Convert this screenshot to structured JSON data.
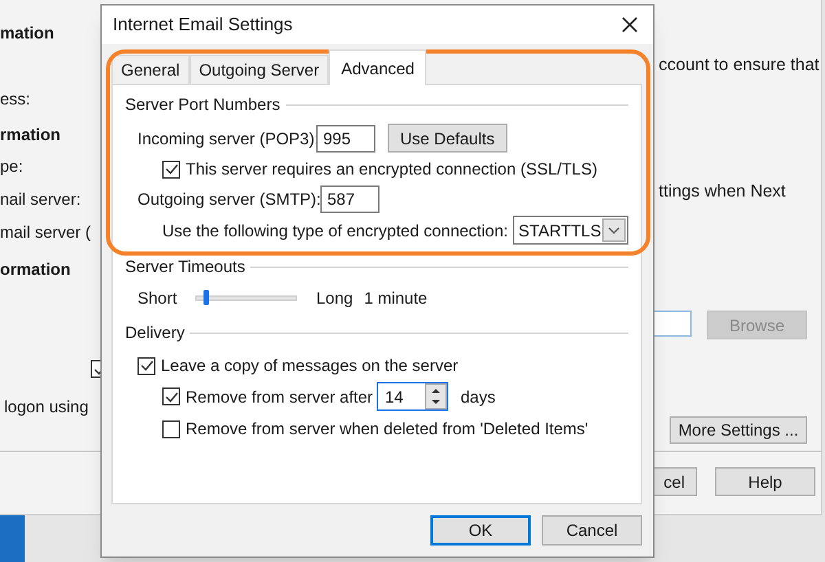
{
  "background_window": {
    "left_labels": [
      {
        "text": "mation",
        "kind": "heading"
      },
      {
        "text": "ess:",
        "kind": "label"
      },
      {
        "text": "rmation",
        "kind": "heading"
      },
      {
        "text": "pe:",
        "kind": "label"
      },
      {
        "text": "nail server:",
        "kind": "label"
      },
      {
        "text": "mail server (",
        "kind": "label"
      },
      {
        "text": "ormation",
        "kind": "heading"
      }
    ],
    "checkbox": {
      "checked": true
    },
    "logon_text": "logon using",
    "notice": "ccount to ensure that",
    "notice_2": "ttings when Next",
    "browse_button": {
      "label": "Browse",
      "disabled": true
    },
    "more_settings_button": "More Settings ...",
    "cancel_button": "cel",
    "help_button": "Help"
  },
  "dialog": {
    "title": "Internet Email Settings",
    "tabs": [
      {
        "label": "General",
        "selected": false
      },
      {
        "label": "Outgoing Server",
        "selected": false
      },
      {
        "label": "Advanced",
        "selected": true
      }
    ],
    "server_port_numbers": {
      "title": "Server Port Numbers",
      "incoming_label": "Incoming server (POP3):",
      "incoming_value": "995",
      "use_defaults_button": "Use Defaults",
      "encrypted_checkbox": {
        "label": "This server requires an encrypted connection (SSL/TLS)",
        "checked": true
      },
      "outgoing_label": "Outgoing server (SMTP):",
      "outgoing_value": "587",
      "encryption_label": "Use the following type of encrypted connection:",
      "encryption_value": "STARTTLS"
    },
    "server_timeouts": {
      "title": "Server Timeouts",
      "short_label": "Short",
      "long_label": "Long",
      "level": 0.1,
      "reading": "1 minute"
    },
    "delivery": {
      "title": "Delivery",
      "leave_copy": {
        "label": "Leave a copy of messages on the server",
        "checked": true
      },
      "remove_after": {
        "label": "Remove from server after",
        "checked": true,
        "value": "14",
        "unit": "days"
      },
      "remove_when_deleted": {
        "label": "Remove from server when deleted from 'Deleted Items'",
        "checked": false
      }
    },
    "buttons": [
      {
        "label": "OK",
        "default": true
      },
      {
        "label": "Cancel",
        "default": false
      }
    ]
  }
}
